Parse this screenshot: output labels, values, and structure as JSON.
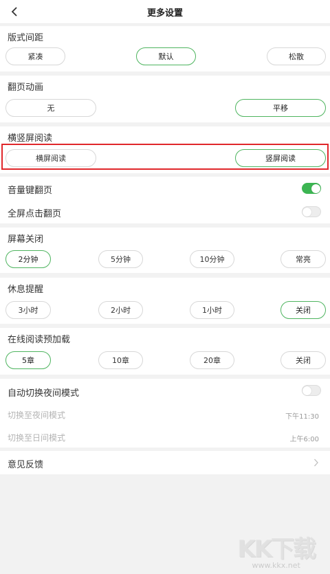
{
  "header": {
    "title": "更多设置"
  },
  "layout_spacing": {
    "title": "版式间距",
    "options": [
      "紧凑",
      "默认",
      "松散"
    ],
    "selected": "默认"
  },
  "page_turn_animation": {
    "title": "翻页动画",
    "options": [
      "无",
      "平移"
    ],
    "selected": "平移"
  },
  "orientation": {
    "title": "横竖屏阅读",
    "options": [
      "横屏阅读",
      "竖屏阅读"
    ],
    "selected": "竖屏阅读"
  },
  "volume_key_turn": {
    "label": "音量键翻页",
    "enabled": true
  },
  "fullscreen_tap_turn": {
    "label": "全屏点击翻页",
    "enabled": false
  },
  "screen_off": {
    "title": "屏幕关闭",
    "options": [
      "2分钟",
      "5分钟",
      "10分钟",
      "常亮"
    ],
    "selected": "2分钟"
  },
  "rest_reminder": {
    "title": "休息提醒",
    "options": [
      "3小时",
      "2小时",
      "1小时",
      "关闭"
    ],
    "selected": "关闭"
  },
  "online_preload": {
    "title": "在线阅读预加载",
    "options": [
      "5章",
      "10章",
      "20章",
      "关闭"
    ],
    "selected": "5章"
  },
  "auto_night_mode": {
    "label": "自动切换夜间模式",
    "enabled": false,
    "to_night": {
      "label": "切换至夜间模式",
      "time": "下午11:30"
    },
    "to_day": {
      "label": "切换至日间模式",
      "time": "上午6:00"
    }
  },
  "feedback": {
    "label": "意见反馈"
  },
  "watermark": {
    "logo": "KK下载",
    "url": "www.kkx.net"
  },
  "colors": {
    "accent": "#3cb552",
    "highlight_box": "#e0262a"
  }
}
